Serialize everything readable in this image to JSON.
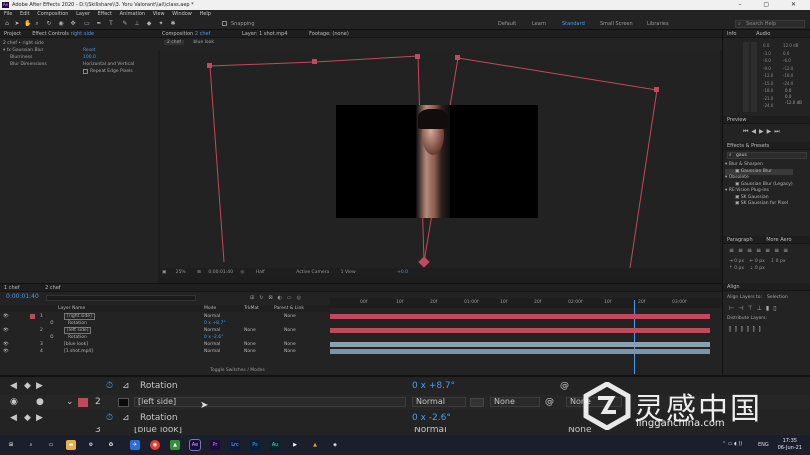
{
  "window": {
    "title": "Adobe After Effects 2020 - D:\\\\Skillshare\\\\3. Yoru Valorant\\\\ai\\\\class.aep *",
    "logo_text": "Ae"
  },
  "menu": [
    "File",
    "Edit",
    "Composition",
    "Layer",
    "Effect",
    "Animation",
    "View",
    "Window",
    "Help"
  ],
  "toolbar": {
    "snapping_label": "Snapping",
    "workspaces": [
      "Default",
      "Learn",
      "Standard",
      "Small Screen",
      "Libraries"
    ],
    "active_workspace": "Standard",
    "search_placeholder": "Search Help"
  },
  "project_panel": {
    "tab_project": "Project",
    "tab_effect_controls": "Effect Controls",
    "effect_controls_layer": "right side",
    "layer_path": "2 chef • right side",
    "effect_name": "Gaussian Blur",
    "reset_label": "Reset",
    "params": [
      {
        "name": "Blurriness",
        "value": "100.0"
      },
      {
        "name": "Blur Dimensions",
        "value": "Horizontal and Vertical"
      },
      {
        "name": "Repeat Edge Pixels",
        "value": ""
      }
    ]
  },
  "composition_panel": {
    "tab_label": "Composition",
    "comp_name": "2 chef",
    "sub_tabs": [
      "2 chef",
      "blue look"
    ],
    "layer_tab": "Layer: 1 shot.mp4",
    "footage_tab": "Footage: (none)",
    "footer": {
      "zoom": "25%",
      "timecode": "0:00:01:40",
      "resolution": "Half",
      "camera": "Active Camera",
      "views": "1 View",
      "offset": "+0.0"
    }
  },
  "info_panel": {
    "tab_info": "Info",
    "tab_audio": "Audio",
    "db_left": [
      "0.0",
      "-3.0",
      "-6.0",
      "-9.0",
      "-12.0",
      "-15.0",
      "-18.0",
      "-21.0",
      "-24.0"
    ],
    "db_right": [
      "12.0 dB",
      "0.0",
      "-6.0",
      "-12.0",
      "-18.0",
      "-24.0"
    ],
    "db_readout": [
      "0.0",
      "0.0",
      "-12.0 dB"
    ]
  },
  "preview_panel": {
    "title": "Preview"
  },
  "effects_presets": {
    "title": "Effects & Presets",
    "search_value": "gaus",
    "groups": [
      {
        "name": "Blur & Sharpen",
        "items": [
          "Gaussian Blur"
        ]
      },
      {
        "name": "Obsolete",
        "items": [
          "Gaussian Blur (Legacy)"
        ]
      },
      {
        "name": "RE:Vision Plug-ins",
        "items": [
          "SK Gaussian",
          "SK Gaussian for Pixel"
        ]
      }
    ]
  },
  "paragraph_panel": {
    "tab_paragraph": "Paragraph",
    "tab_more": "More Aero"
  },
  "align_panel": {
    "title": "Align",
    "align_layers_to_label": "Align Layers to:",
    "align_layers_to_value": "Selection",
    "distribute_label": "Distribute Layers:"
  },
  "timeline": {
    "tabs": [
      "1 chef",
      "2 chef"
    ],
    "timecode": "0:00:01:40",
    "columns": {
      "layer_name": "Layer Name",
      "mode": "Mode",
      "trkmat": "TrkMat",
      "parent": "Parent & Link"
    },
    "toggle_label": "Toggle Switches / Modes",
    "ruler_ticks": [
      "00f",
      "10f",
      "20f",
      "01:00f",
      "10f",
      "20f",
      "02:00f",
      "10f",
      "20f",
      "03:00f"
    ],
    "layers": [
      {
        "num": "1",
        "name": "[right side]",
        "mode": "Normal",
        "trkmat": "",
        "parent": "None",
        "color": "#c04a5a"
      },
      {
        "num": "",
        "name": "Rotation",
        "mode": "0 x +8.7°",
        "trkmat": "",
        "parent": "",
        "color": ""
      },
      {
        "num": "2",
        "name": "[left side]",
        "mode": "Normal",
        "trkmat": "None",
        "parent": "None",
        "color": "#c04a5a"
      },
      {
        "num": "",
        "name": "Rotation",
        "mode": "0 x -2.6°",
        "trkmat": "",
        "parent": "",
        "color": ""
      },
      {
        "num": "3",
        "name": "[blue look]",
        "mode": "Normal",
        "trkmat": "None",
        "parent": "None",
        "color": "#8aa0b4"
      },
      {
        "num": "4",
        "name": "[1 shot.mp4]",
        "mode": "Normal",
        "trkmat": "None",
        "parent": "None",
        "color": "#8aa0b4"
      }
    ]
  },
  "zoom_strip": {
    "rows": [
      {
        "label": "Rotation",
        "value": "0 x +8.7°"
      },
      {
        "num": "2",
        "label": "[left side]",
        "mode": "Normal",
        "trkmat": "None",
        "parent": "None"
      },
      {
        "label": "Rotation",
        "value": "0 x -2.6°"
      },
      {
        "num": "3",
        "label": "[blue look]",
        "mode": "Normal",
        "parent": "None"
      }
    ]
  },
  "watermark": {
    "cn_text": "灵感中国",
    "url": "lingganchina.com"
  },
  "taskbar": {
    "apps": [
      "Ae",
      "Pr",
      "Lrc",
      "Ps",
      "Au"
    ],
    "time": "17:35",
    "date": "06-Jun-21",
    "lang": "ENG"
  },
  "colors": {
    "accent": "#4a9bf0",
    "layer_red": "#c04a5a",
    "layer_blue": "#8aa0b4",
    "playhead": "#4a9bf0"
  }
}
